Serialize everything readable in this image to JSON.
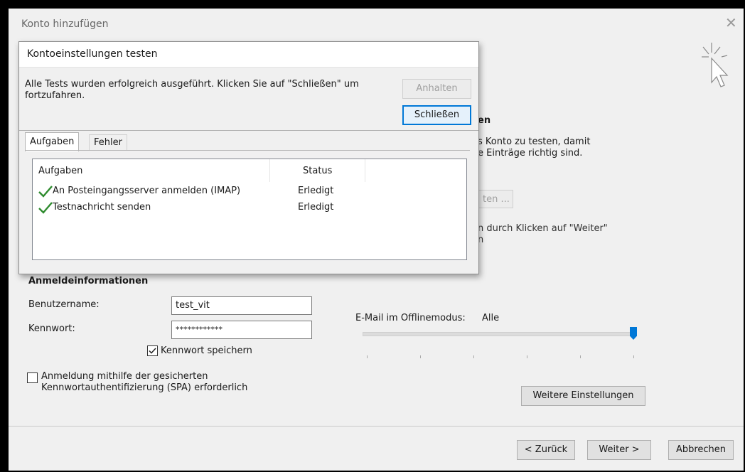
{
  "window": {
    "title": "Konto hinzufügen",
    "close_glyph": "✕",
    "icon": "cursor-click-icon"
  },
  "background_form": {
    "section_heading_partial": "en",
    "desc_line1_partial": "s Konto zu testen, damit",
    "desc_line2_partial": "e Einträge richtig sind.",
    "test_button_partial": "ten ...",
    "next_line1_partial": "n durch Klicken auf \"Weiter\"",
    "next_line2_partial": "n",
    "login_heading": "Anmeldeinformationen",
    "username_label": "Benutzername:",
    "username_value": "test_vit",
    "password_label": "Kennwort:",
    "password_value": "************",
    "remember_password_label": "Kennwort speichern",
    "remember_password_checked": true,
    "spa_label_line1": "Anmeldung mithilfe der gesicherten",
    "spa_label_line2": "Kennwortauthentifizierung (SPA) erforderlich",
    "spa_checked": false,
    "offline_label": "E-Mail im Offlinemodus:",
    "offline_value": "Alle",
    "offline_slider_level": 1.0,
    "more_settings_button": "Weitere Einstellungen"
  },
  "footer": {
    "back_button": "< Zurück",
    "next_button": "Weiter >",
    "cancel_button": "Abbrechen"
  },
  "dialog": {
    "title": "Kontoeinstellungen testen",
    "message_line1": "Alle Tests wurden erfolgreich ausgeführt. Klicken Sie auf \"Schließen\" um",
    "message_line2": "fortzufahren.",
    "stop_button": "Anhalten",
    "close_button": "Schließen",
    "tabs": [
      "Aufgaben",
      "Fehler"
    ],
    "columns": [
      "Aufgaben",
      "Status"
    ],
    "tasks": [
      {
        "name": "An Posteingangsserver anmelden (IMAP)",
        "status": "Erledigt",
        "icon": "checkmark-icon"
      },
      {
        "name": "Testnachricht senden",
        "status": "Erledigt",
        "icon": "checkmark-icon"
      }
    ],
    "check_color": "#2e8b2e",
    "accent_color": "#0078d7"
  }
}
